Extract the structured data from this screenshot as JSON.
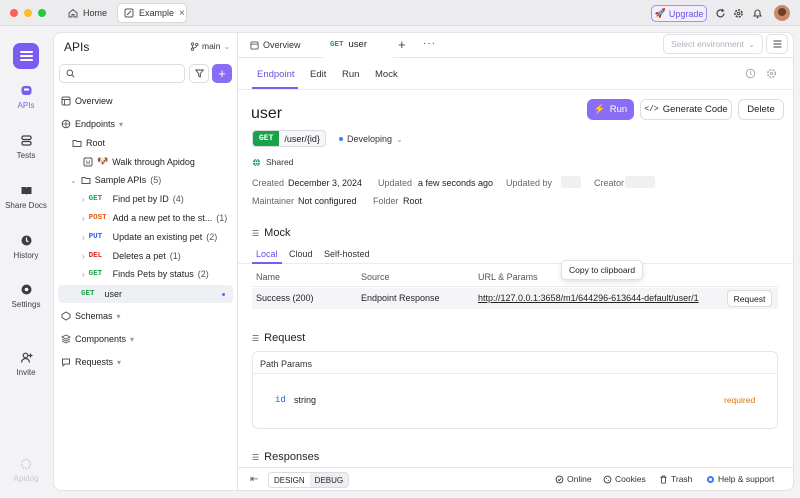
{
  "titlebar": {
    "tabs": [
      {
        "label": "Home"
      },
      {
        "label": "Example"
      }
    ],
    "upgrade_label": "Upgrade"
  },
  "rail": {
    "items": [
      {
        "label": "APIs",
        "icon": "apis-icon"
      },
      {
        "label": "Tests",
        "icon": "tests-icon"
      },
      {
        "label": "Share Docs",
        "icon": "share-docs-icon"
      },
      {
        "label": "History",
        "icon": "history-icon"
      },
      {
        "label": "Settings",
        "icon": "settings-icon"
      },
      {
        "label": "Invite",
        "icon": "invite-icon"
      }
    ],
    "brand": "Apidog"
  },
  "sidebar": {
    "title": "APIs",
    "branch": "main",
    "overview": "Overview",
    "endpoints": "Endpoints",
    "root": "Root",
    "walkthrough": "Walk through Apidog",
    "folder": {
      "label": "Sample APIs",
      "count": "(5)"
    },
    "endpoints_list": [
      {
        "method": "GET",
        "name": "Find pet by ID",
        "count": "(4)"
      },
      {
        "method": "POST",
        "name": "Add a new pet to the st...",
        "count": "(1)"
      },
      {
        "method": "PUT",
        "name": "Update an existing pet",
        "count": "(2)"
      },
      {
        "method": "DEL",
        "name": "Deletes a pet",
        "count": "(1)"
      },
      {
        "method": "GET",
        "name": "Finds Pets by status",
        "count": "(2)"
      }
    ],
    "active_item": {
      "method": "GET",
      "name": "user"
    },
    "schemas": "Schemas",
    "components": "Components",
    "requests": "Requests"
  },
  "main": {
    "tabs": [
      {
        "label": "Overview"
      },
      {
        "method": "GET",
        "label": "user"
      }
    ],
    "env_placeholder": "Select environment",
    "subtabs": [
      "Endpoint",
      "Edit",
      "Run",
      "Mock"
    ],
    "title": "user",
    "buttons": {
      "run": "Run",
      "generate": "Generate Code",
      "delete": "Delete"
    },
    "method": "GET",
    "path": "/user/{id}",
    "status": "Developing",
    "shared": "Shared",
    "meta": {
      "created_label": "Created",
      "created": "December 3, 2024",
      "updated_label": "Updated",
      "updated": "a few seconds ago",
      "updated_by_label": "Updated by",
      "creator_label": "Creator",
      "maintainer_label": "Maintainer",
      "maintainer": "Not configured",
      "folder_label": "Folder",
      "folder": "Root"
    },
    "mock": {
      "title": "Mock",
      "tabs": [
        "Local",
        "Cloud",
        "Self-hosted"
      ],
      "columns": [
        "Name",
        "Source",
        "URL & Params"
      ],
      "row": {
        "name": "Success (200)",
        "source": "Endpoint Response",
        "url": "http://127.0.0.1:3658/m1/644296-613644-default/user/1",
        "action": "Request"
      },
      "tooltip": "Copy to clipboard"
    },
    "request": {
      "title": "Request",
      "path_params": "Path Params",
      "param": {
        "name": "id",
        "type": "string",
        "required": "required"
      }
    },
    "responses_title": "Responses"
  },
  "footer": {
    "design": "DESIGN",
    "debug": "DEBUG",
    "online": "Online",
    "cookies": "Cookies",
    "trash": "Trash",
    "help": "Help & support"
  },
  "colors": {
    "accent": "#7a5cf0",
    "get": "#16a34a",
    "post": "#ea580c",
    "put": "#2563eb",
    "del": "#dc2626",
    "required": "#d97706"
  }
}
